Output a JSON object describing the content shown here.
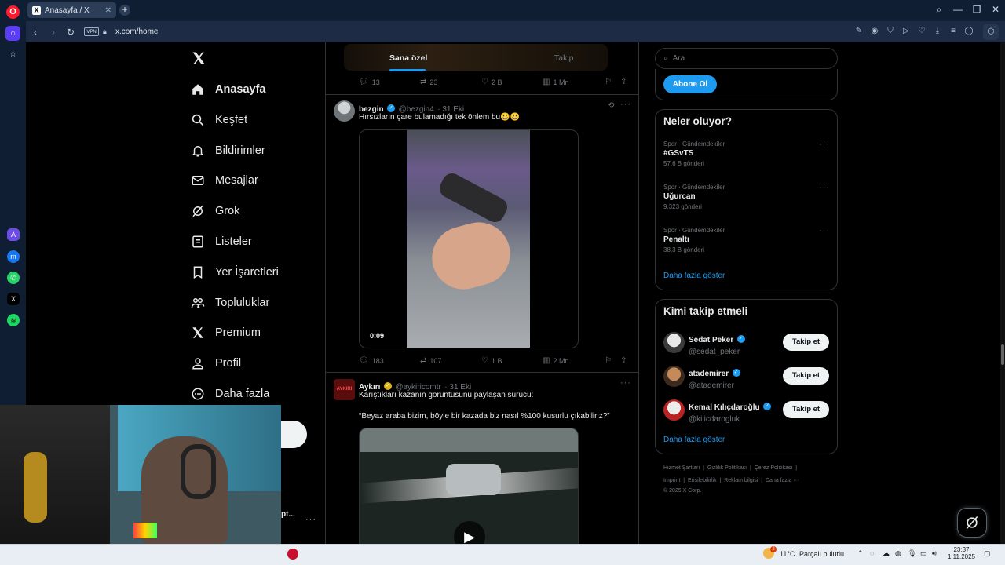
{
  "browser": {
    "tab_title": "Anasayfa / X",
    "url": "x.com/home",
    "vpn_label": "VPN"
  },
  "nav": {
    "items": [
      {
        "label": "Anasayfa",
        "icon": "home-icon"
      },
      {
        "label": "Keşfet",
        "icon": "search-icon"
      },
      {
        "label": "Bildirimler",
        "icon": "bell-icon"
      },
      {
        "label": "Mesajlar",
        "icon": "mail-icon"
      },
      {
        "label": "Grok",
        "icon": "grok-icon"
      },
      {
        "label": "Listeler",
        "icon": "list-icon"
      },
      {
        "label": "Yer İşaretleri",
        "icon": "bookmark-icon"
      },
      {
        "label": "Topluluklar",
        "icon": "community-icon"
      },
      {
        "label": "Premium",
        "icon": "x-logo-icon"
      },
      {
        "label": "Profil",
        "icon": "person-icon"
      },
      {
        "label": "Daha fazla",
        "icon": "more-circle-icon"
      }
    ],
    "account_partial": "pt..."
  },
  "feed": {
    "tabs": [
      "Sana özel",
      "Takip"
    ],
    "top_actions": {
      "replies": "13",
      "reposts": "23",
      "likes": "2 B",
      "views": "1 Mn"
    },
    "tweet1": {
      "name": "bezgin",
      "handle": "@bezgin4",
      "date": "· 31 Eki",
      "text": "Hırsızların çare bulamadığı tek önlem bu😃😃",
      "video_time": "0:09",
      "replies": "183",
      "reposts": "107",
      "likes": "1 B",
      "views": "2 Mn"
    },
    "tweet2": {
      "name": "Aykırı",
      "handle": "@aykiricomtr",
      "date": "· 31 Eki",
      "avatar_text": "AYKIRI",
      "text_line1": "Karıştıkları kazanın görüntüsünü paylaşan sürücü:",
      "text_line2": "“Beyaz araba bizim, böyle bir kazada biz nasıl %100 kusurlu çıkabiliriz?”"
    }
  },
  "right": {
    "search_placeholder": "Ara",
    "subscribe_label": "Abone Ol",
    "trends_title": "Neler oluyor?",
    "trends": [
      {
        "category": "Spor · Gündemdekiler",
        "name": "#GSvTS",
        "count": "57,6 B gönderi"
      },
      {
        "category": "Spor · Gündemdekiler",
        "name": "Uğurcan",
        "count": "9.323 gönderi"
      },
      {
        "category": "Spor · Gündemdekiler",
        "name": "Penaltı",
        "count": "38,3 B gönderi"
      }
    ],
    "show_more": "Daha fazla göster",
    "who_title": "Kimi takip etmeli",
    "who": [
      {
        "name": "Sedat Peker",
        "handle": "@sedat_peker"
      },
      {
        "name": "atademirer",
        "handle": "@atademirer"
      },
      {
        "name": "Kemal Kılıçdaroğlu",
        "handle": "@kilicdarogluk"
      }
    ],
    "follow_label": "Takip et",
    "footer": {
      "l1": "Hizmet Şartları",
      "l2": "Gizlilik Politikası",
      "l3": "Çerez Politikası",
      "l4": "Imprint",
      "l5": "Erişilebilirlik",
      "l6": "Reklam bilgisi",
      "l7": "Daha fazla ···",
      "copy": "© 2025 X Corp."
    }
  },
  "taskbar": {
    "temperature": "11°C",
    "weather": "Parçalı bulutlu",
    "time": "23:37",
    "date": "1.11.2025",
    "weather_badge": "2"
  },
  "colors": {
    "accent": "#1d9bf0",
    "gold_check": "#e2b719",
    "background": "#000000",
    "border": "#2f3336"
  }
}
